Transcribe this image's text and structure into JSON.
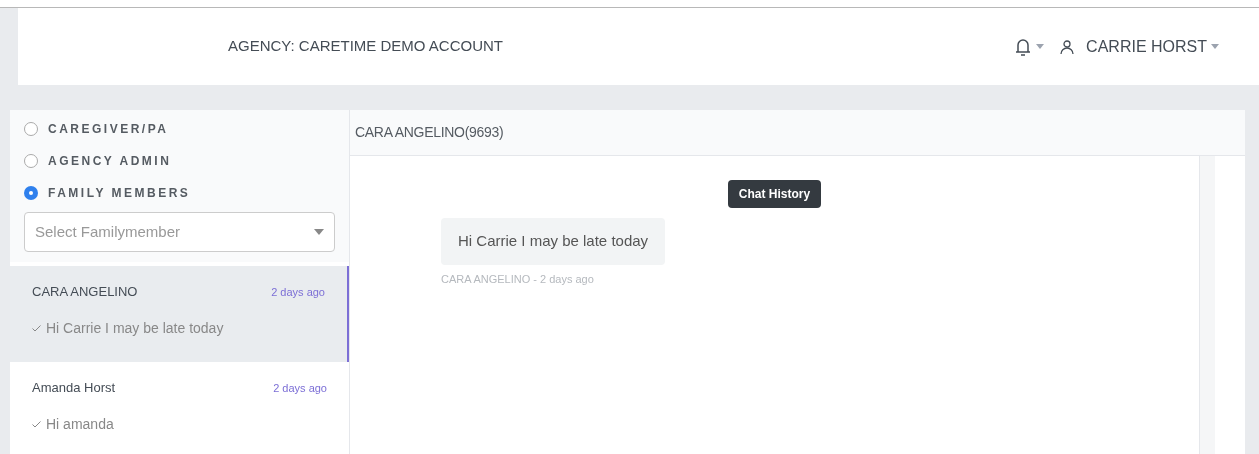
{
  "header": {
    "agency": "AGENCY: CARETIME DEMO ACCOUNT",
    "user": "CARRIE HORST"
  },
  "roles": [
    {
      "label": "CAREGIVER/PA",
      "selected": false
    },
    {
      "label": "AGENCY ADMIN",
      "selected": false
    },
    {
      "label": "FAMILY MEMBERS",
      "selected": true
    }
  ],
  "member_select": {
    "placeholder": "Select Familymember"
  },
  "conversations": [
    {
      "name": "CARA ANGELINO",
      "time": "2 days ago",
      "preview": "Hi Carrie I may be late today",
      "selected": true
    },
    {
      "name": "Amanda Horst",
      "time": "2 days ago",
      "preview": "Hi amanda",
      "selected": false
    }
  ],
  "chat": {
    "title": "CARA ANGELINO(9693)",
    "badge": "Chat History",
    "messages": [
      {
        "text": "Hi Carrie I may be late today",
        "meta": "CARA ANGELINO - 2 days ago"
      }
    ]
  }
}
